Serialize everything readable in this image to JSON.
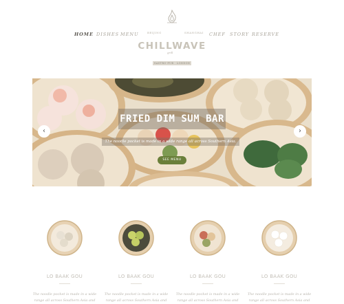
{
  "nav_left": [
    {
      "label": "HOME",
      "active": true
    },
    {
      "label": "DISHES",
      "active": false
    },
    {
      "label": "MENU",
      "active": false
    }
  ],
  "nav_right": [
    {
      "label": "CHEF",
      "active": false
    },
    {
      "label": "STORY",
      "active": false
    },
    {
      "label": "RESERVE",
      "active": false
    }
  ],
  "logo": {
    "est_left": "BEIJING",
    "est_right": "SHANGHAI",
    "name": "CHILLWAVE",
    "sub": "grill",
    "ribbon": "GASTRO-PUB · LONDON",
    "icon": "flame-icon"
  },
  "hero": {
    "title": "FRIED DIM SUM BAR",
    "tagline": "The noodle pocket is made in a wide range all across Southern Asia.",
    "button": "SEE MENU",
    "prev_icon": "chevron-left-icon",
    "next_icon": "chevron-right-icon"
  },
  "dishes": [
    {
      "title": "LO BAAK GOU",
      "text": "The noodle pocket is made in a wide range all across Southern Asia and"
    },
    {
      "title": "LO BAAK GOU",
      "text": "The noodle pocket is made in a wide range all across Southern Asia and"
    },
    {
      "title": "LO BAAK GOU",
      "text": "The noodle pocket is made in a wide range all across Southern Asia and"
    },
    {
      "title": "LO BAAK GOU",
      "text": "The noodle pocket is made in a wide range all across Southern Asia and"
    }
  ],
  "colors": {
    "accent": "#6a7f3a",
    "bamboo": "#d9b98f",
    "bun": "#f3d8d0"
  }
}
